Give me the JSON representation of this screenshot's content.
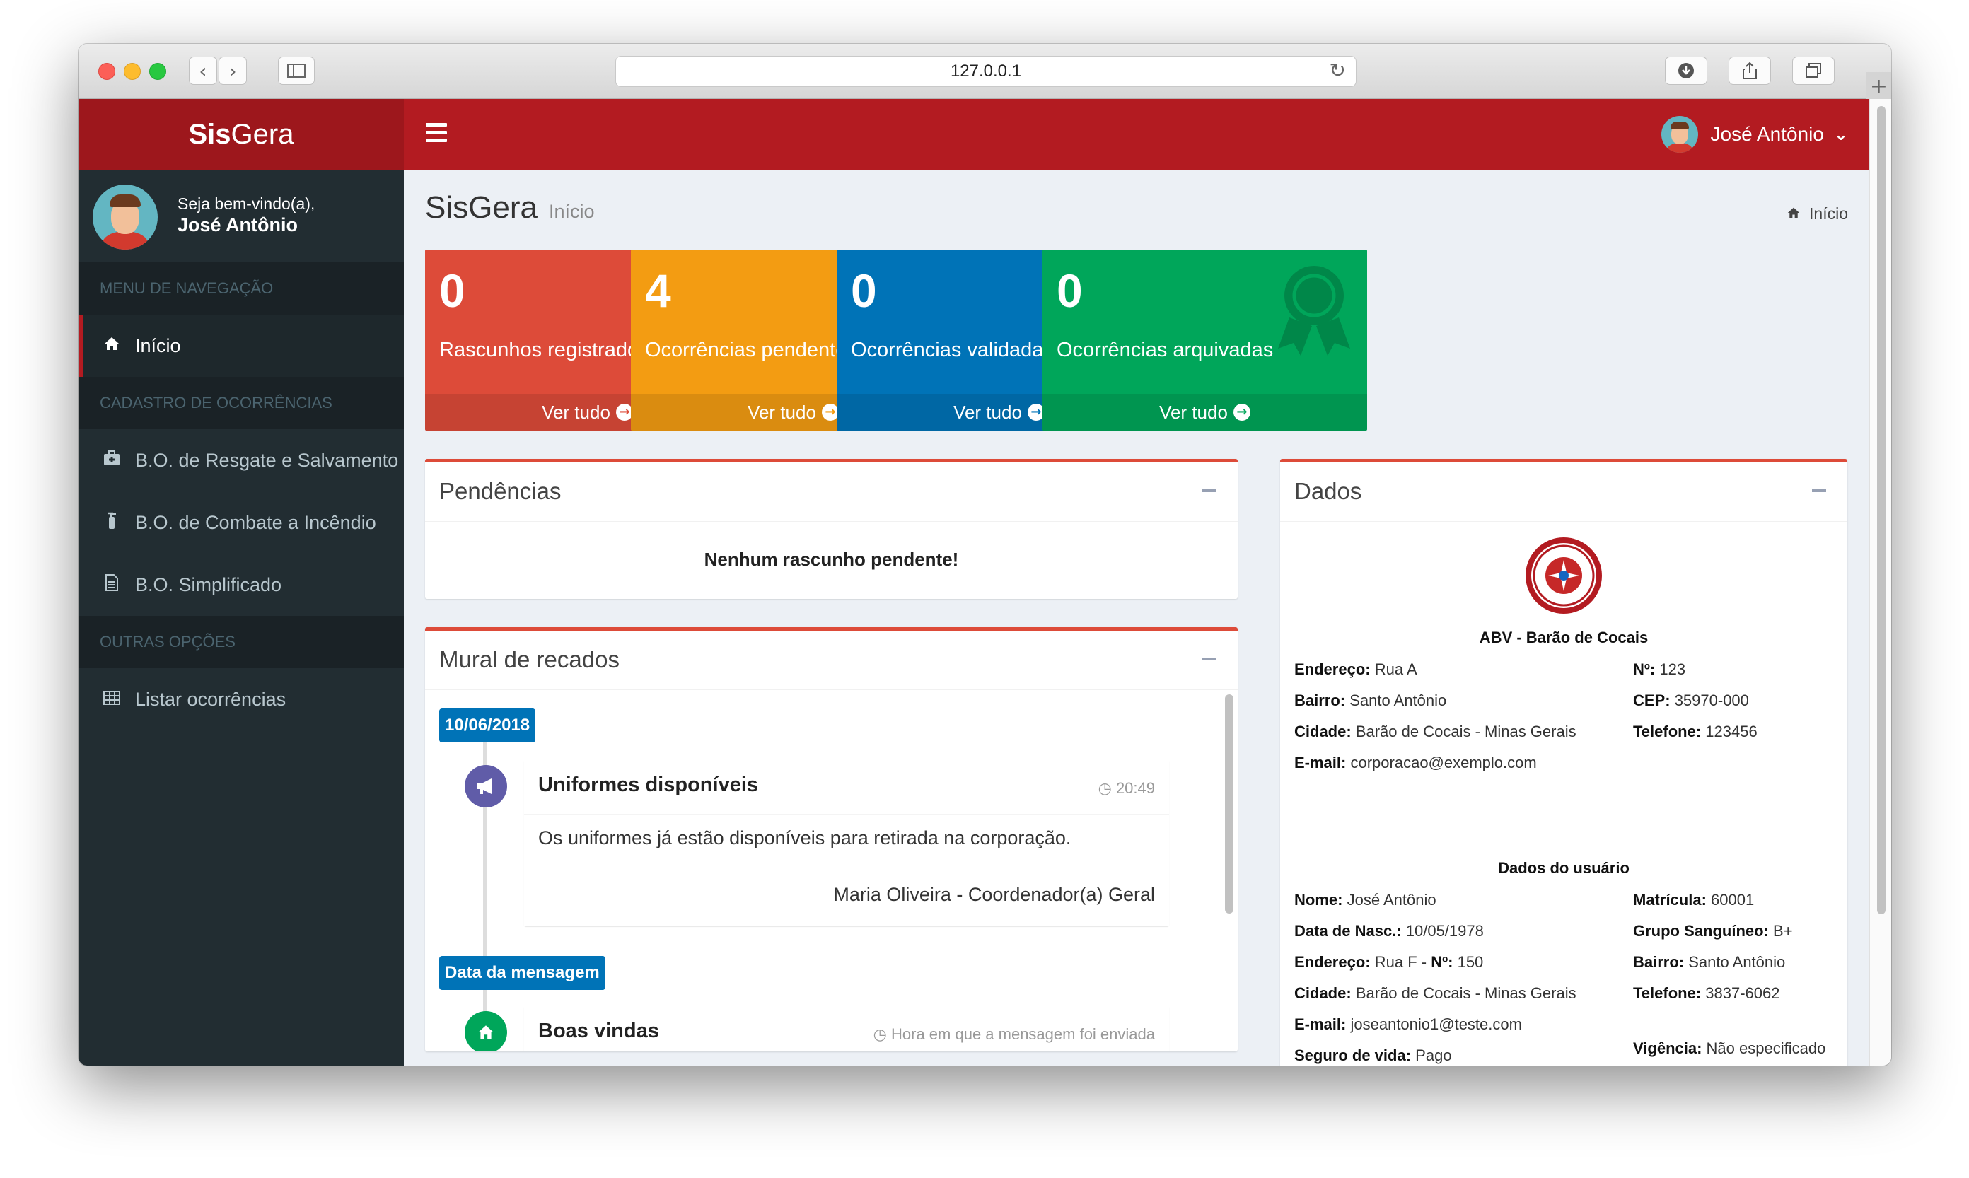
{
  "browser": {
    "url": "127.0.0.1"
  },
  "app": {
    "brand_bold": "Sis",
    "brand_light": "Gera"
  },
  "topbar": {
    "user_name": "José Antônio"
  },
  "sidebar": {
    "welcome": "Seja bem-vindo(a),",
    "user_name": "José Antônio",
    "sections": [
      {
        "header": "MENU DE NAVEGAÇÃO",
        "items": [
          {
            "label": "Início",
            "icon": "home-icon"
          }
        ]
      },
      {
        "header": "CADASTRO DE OCORRÊNCIAS",
        "items": [
          {
            "label": "B.O. de Resgate e Salvamento",
            "icon": "medkit-icon"
          },
          {
            "label": "B.O. de Combate a Incêndio",
            "icon": "fire-extinguisher-icon"
          },
          {
            "label": "B.O. Simplificado",
            "icon": "file-text-icon"
          }
        ]
      },
      {
        "header": "OUTRAS OPÇÕES",
        "items": [
          {
            "label": "Listar ocorrências",
            "icon": "table-icon"
          }
        ]
      }
    ]
  },
  "header": {
    "title": "SisGera",
    "subtitle": "Início",
    "breadcrumb": "Início"
  },
  "stats": [
    {
      "value": "0",
      "label": "Rascunhos registrados",
      "link": "Ver tudo",
      "color": "#dd4b39",
      "icon": "file-icon"
    },
    {
      "value": "4",
      "label": "Ocorrências pendentes",
      "link": "Ver tudo",
      "color": "#f39c12",
      "icon": "warning-icon"
    },
    {
      "value": "0",
      "label": "Ocorrências validadas",
      "link": "Ver tudo",
      "color": "#0073b7",
      "icon": "check-icon"
    },
    {
      "value": "0",
      "label": "Ocorrências arquivadas",
      "link": "Ver tudo",
      "color": "#00a65a",
      "icon": "award-icon"
    }
  ],
  "pendencias": {
    "title": "Pendências",
    "message": "Nenhum rascunho pendente!"
  },
  "mural": {
    "title": "Mural de recados",
    "groups": [
      {
        "date": "10/06/2018",
        "title": "Uniformes disponíveis",
        "time": "20:49",
        "body": "Os uniformes já estão disponíveis para retirada na corporação.",
        "author": "Maria Oliveira - Coordenador(a) Geral"
      },
      {
        "date": "Data da mensagem",
        "title": "Boas vindas",
        "time": "Hora em que a mensagem foi enviada"
      }
    ]
  },
  "dados": {
    "title": "Dados",
    "org_name": "ABV - Barão de Cocais",
    "org": {
      "endereco": "Rua A",
      "numero": "123",
      "bairro": "Santo Antônio",
      "cep": "35970-000",
      "cidade": "Barão de Cocais - Minas Gerais",
      "telefone": "123456",
      "email": "corporacao@exemplo.com"
    },
    "user_title": "Dados do usuário",
    "user": {
      "nome": "José Antônio",
      "matricula": "60001",
      "nascimento": "10/05/1978",
      "sangue": "B+",
      "endereco": "Rua F",
      "numero": "150",
      "bairro": "Santo Antônio",
      "cidade": "Barão de Cocais - Minas Gerais",
      "telefone": "3837-6062",
      "email": "joseantonio1@teste.com",
      "seguro": "Pago",
      "vigencia": "Não especificado"
    },
    "labels": {
      "endereco": "Endereço:",
      "numero": "Nº:",
      "bairro": "Bairro:",
      "cep": "CEP:",
      "cidade": "Cidade:",
      "telefone": "Telefone:",
      "email": "E-mail:",
      "nome": "Nome:",
      "matricula": "Matrícula:",
      "nascimento": "Data de Nasc.:",
      "sangue": "Grupo Sanguíneo:",
      "seguro": "Seguro de vida:",
      "vigencia": "Vigência:"
    }
  }
}
